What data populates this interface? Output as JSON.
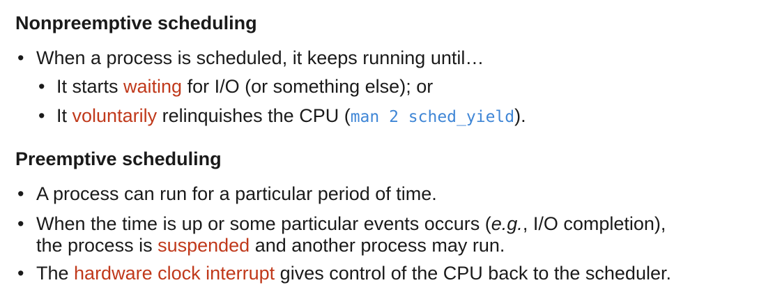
{
  "sections": [
    {
      "heading": "Nonpreemptive scheduling",
      "bullets": [
        {
          "text_before": "When a process is scheduled, it keeps running until…",
          "sub": [
            {
              "prefix": "It starts ",
              "accent": "waiting",
              "suffix": " for I/O (or something else); or"
            },
            {
              "prefix": "It ",
              "accent": "voluntarily",
              "middle": " relinquishes the CPU (",
              "code": "man 2 sched_yield",
              "suffix": ")."
            }
          ]
        }
      ]
    },
    {
      "heading": "Preemptive scheduling",
      "bullets": [
        {
          "text": "A process can run for a particular period of time."
        },
        {
          "line1_prefix": "When the time is up or some particular events occurs (",
          "line1_italic": "e.g.",
          "line1_suffix": ", I/O completion),",
          "line2_prefix": "the process is ",
          "line2_accent": "suspended",
          "line2_suffix": " and another process may run."
        },
        {
          "prefix": "The ",
          "accent": "hardware clock interrupt",
          "suffix": " gives control of the CPU back to the scheduler."
        }
      ]
    }
  ],
  "bullet_glyph": "•",
  "colors": {
    "text": "#1a1a1a",
    "accent": "#c0391b",
    "code": "#3f86d6"
  }
}
